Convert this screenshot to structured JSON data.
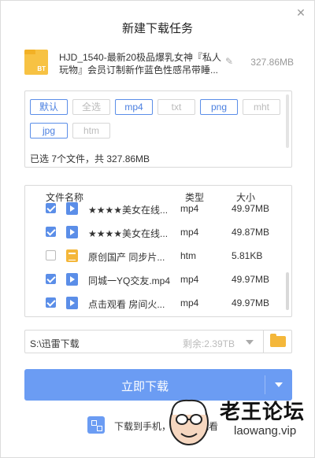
{
  "dialog": {
    "title": "新建下载任务",
    "close_glyph": "✕"
  },
  "file": {
    "icon_label": "BT",
    "name": "HJD_1540-最新20极品爆乳女神『私人玩物』会员订制新作蓝色性感吊带睡...",
    "size": "327.86MB",
    "edit_icon": "pencil-icon"
  },
  "filters": {
    "tags": [
      {
        "label": "默认",
        "active": true
      },
      {
        "label": "全选",
        "active": false
      },
      {
        "label": "mp4",
        "active": true
      },
      {
        "label": "txt",
        "active": false
      },
      {
        "label": "png",
        "active": true
      },
      {
        "label": "mht",
        "active": false
      },
      {
        "label": "jpg",
        "active": true
      },
      {
        "label": "htm",
        "active": false
      }
    ],
    "summary": "已选 7个文件，共 327.86MB"
  },
  "list": {
    "headers": {
      "name": "文件名称",
      "type": "类型",
      "size": "大小"
    },
    "rows": [
      {
        "checked": true,
        "icon": "video",
        "name": "★★★★美女在线...",
        "type": "mp4",
        "size": "49.97MB"
      },
      {
        "checked": true,
        "icon": "video",
        "name": "★★★★美女在线...",
        "type": "mp4",
        "size": "49.87MB"
      },
      {
        "checked": false,
        "icon": "doc",
        "name": "原创国产 同步片...",
        "type": "htm",
        "size": "5.81KB"
      },
      {
        "checked": true,
        "icon": "video",
        "name": "同城一YQ交友.mp4",
        "type": "mp4",
        "size": "49.97MB"
      },
      {
        "checked": true,
        "icon": "video",
        "name": "点击观看 房间火...",
        "type": "mp4",
        "size": "49.97MB"
      }
    ]
  },
  "path": {
    "value": "S:\\迅雷下载",
    "free_space": "剩余:2.39TB"
  },
  "download": {
    "label": "立即下载"
  },
  "mobile": {
    "text": "下载到手机，边下边观看"
  },
  "watermark": {
    "text": "老王论坛",
    "url": "laowang.vip"
  },
  "colors": {
    "accent": "#6b9cf3",
    "folder": "#f4b73a"
  }
}
